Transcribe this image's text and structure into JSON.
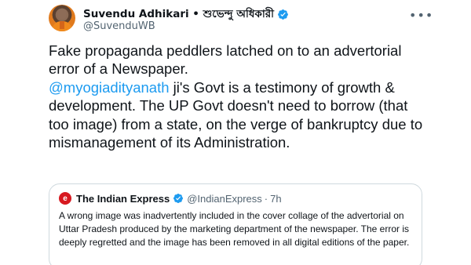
{
  "author": {
    "display_name": "Suvendu Adhikari • শুভেন্দু অধিকারী",
    "handle": "@SuvenduWB",
    "verified_icon": "verified-badge-icon"
  },
  "menu": {
    "more_label": "•••"
  },
  "tweet": {
    "line1": "Fake propaganda peddlers latched on to an advertorial error of a Newspaper.",
    "mention": "@myogiadityanath",
    "line2": " ji's Govt is a testimony of growth & development. The UP Govt doesn't need to borrow (that too image) from a state, on the verge of bankruptcy due to mismanagement of its Administration."
  },
  "quoted_tweet": {
    "logo_text": "e",
    "name": "The Indian Express",
    "handle": "@IndianExpress",
    "separator": "·",
    "time": "7h",
    "text": "A wrong image was inadvertently included in the cover collage of the advertorial on Uttar Pradesh produced by the marketing department of the newspaper. The error is deeply regretted and the image has been removed in all digital editions of the paper."
  },
  "colors": {
    "accent": "#1d9bf0",
    "secondary_text": "#536471",
    "border": "#cfd9de",
    "express_red": "#d71920"
  }
}
